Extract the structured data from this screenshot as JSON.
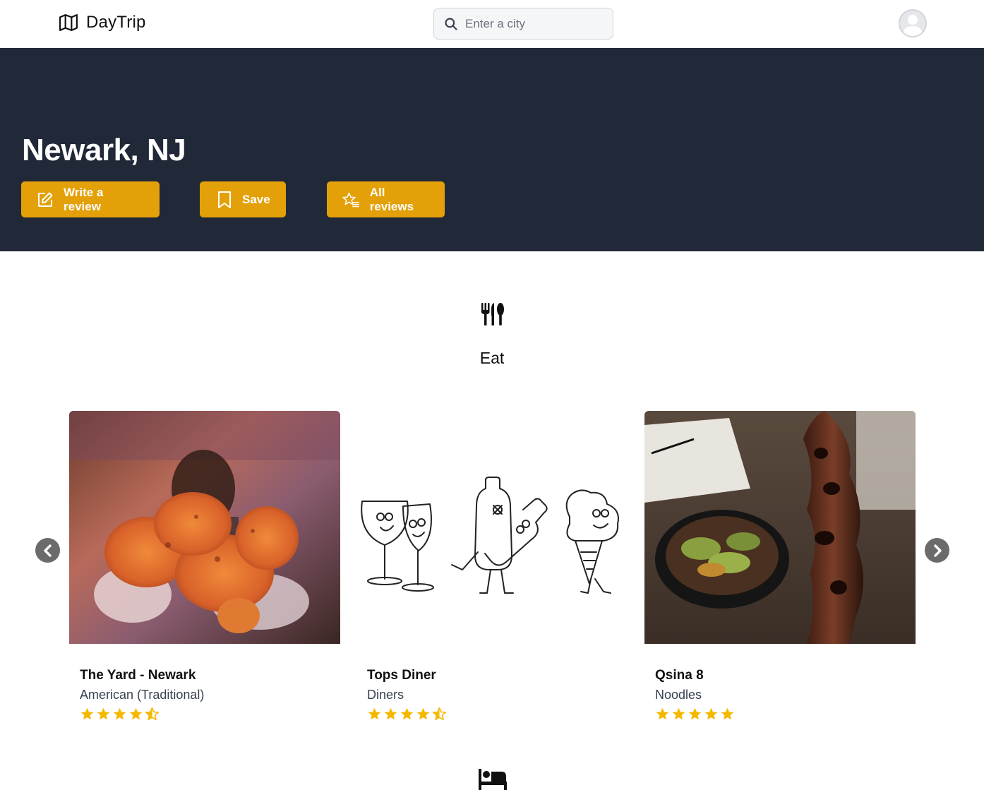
{
  "header": {
    "brand": "DayTrip",
    "search_placeholder": "Enter a city"
  },
  "hero": {
    "city": "Newark, NJ",
    "buttons": {
      "write_review": "Write a review",
      "save": "Save",
      "all_reviews": "All reviews"
    },
    "background_color": "#212938",
    "accent_color": "#e3a008"
  },
  "section": {
    "title": "Eat",
    "icon": "utensils-icon"
  },
  "cards": [
    {
      "name": "The Yard - Newark",
      "category": "American (Traditional)",
      "rating": 4.5
    },
    {
      "name": "Tops Diner",
      "category": "Diners",
      "rating": 4.5
    },
    {
      "name": "Qsina 8",
      "category": "Noodles",
      "rating": 5
    }
  ],
  "next_section_icon": "bed-icon",
  "star_color": "#f5b800"
}
